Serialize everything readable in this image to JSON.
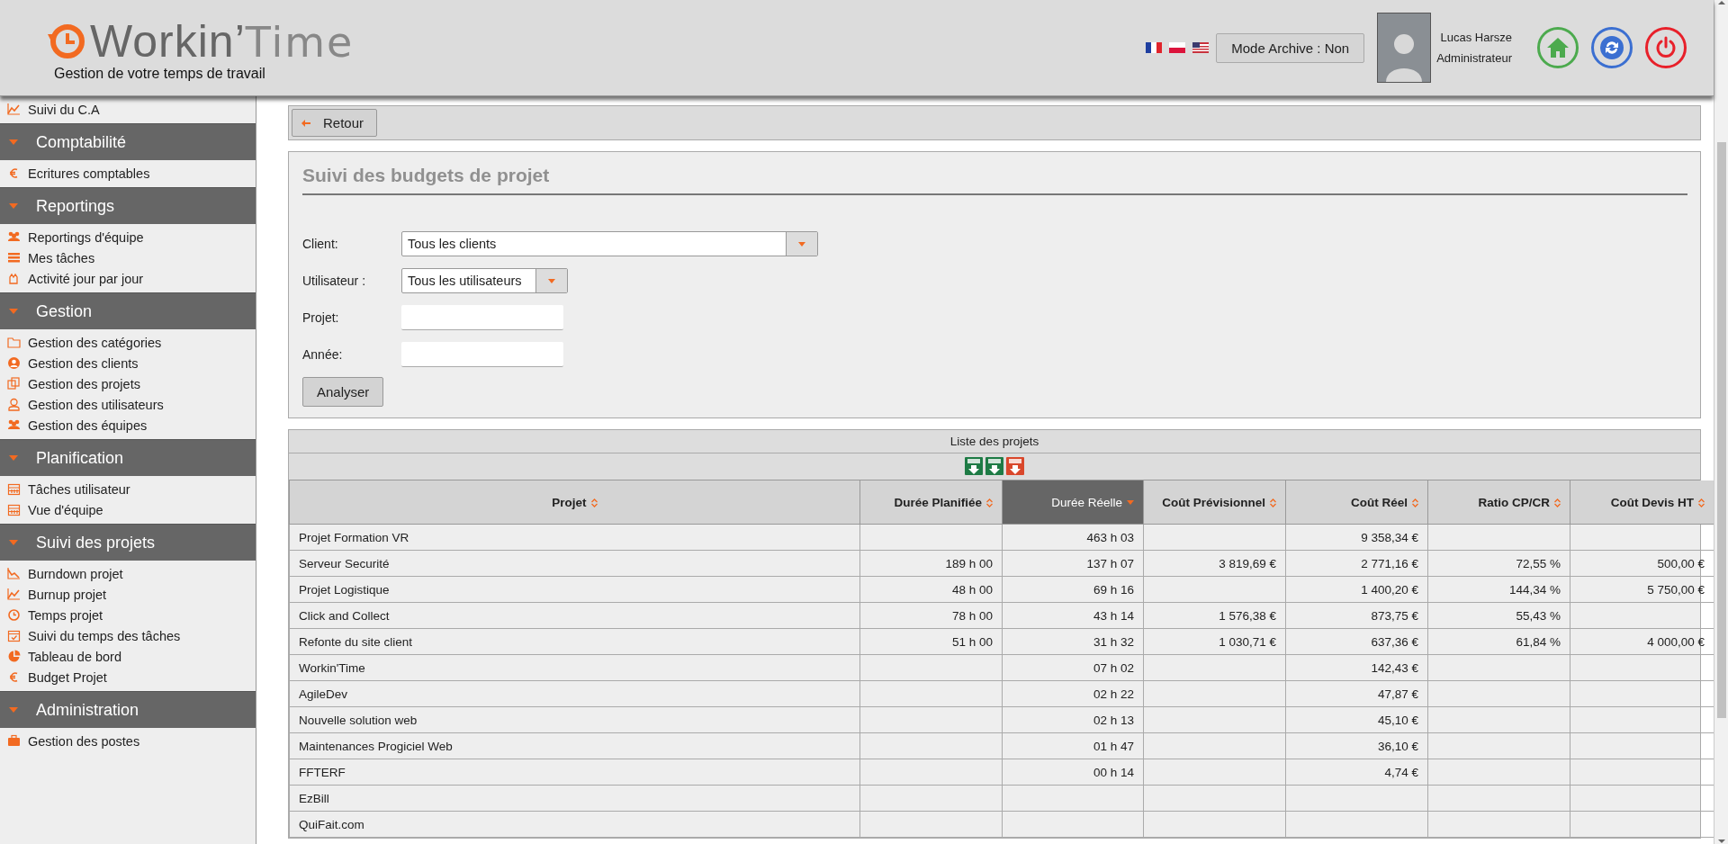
{
  "header": {
    "logo": {
      "bold": "Workin’",
      "light": "Time"
    },
    "tagline": "Gestion de votre temps de travail",
    "archive_button": "Mode Archive : Non",
    "user": {
      "name": "Lucas Harsze",
      "role": "Administrateur"
    }
  },
  "sidebar": {
    "top_items": [
      {
        "label": "Suivi du C.A"
      }
    ],
    "sections": [
      {
        "title": "Comptabilité",
        "items": [
          {
            "label": "Ecritures comptables"
          }
        ]
      },
      {
        "title": "Reportings",
        "items": [
          {
            "label": "Reportings d'équipe"
          },
          {
            "label": "Mes tâches"
          },
          {
            "label": "Activité jour par jour"
          }
        ]
      },
      {
        "title": "Gestion",
        "items": [
          {
            "label": "Gestion des catégories"
          },
          {
            "label": "Gestion des clients"
          },
          {
            "label": "Gestion des projets"
          },
          {
            "label": "Gestion des utilisateurs"
          },
          {
            "label": "Gestion des équipes"
          }
        ]
      },
      {
        "title": "Planification",
        "items": [
          {
            "label": "Tâches utilisateur"
          },
          {
            "label": "Vue d'équipe"
          }
        ]
      },
      {
        "title": "Suivi des projets",
        "items": [
          {
            "label": "Burndown projet"
          },
          {
            "label": "Burnup projet"
          },
          {
            "label": "Temps projet"
          },
          {
            "label": "Suivi du temps des tâches"
          },
          {
            "label": "Tableau de bord"
          },
          {
            "label": "Budget Projet"
          }
        ]
      },
      {
        "title": "Administration",
        "items": [
          {
            "label": "Gestion des postes"
          }
        ]
      }
    ]
  },
  "back_button": "Retour",
  "form": {
    "title": "Suivi des budgets de projet",
    "fields": [
      {
        "kind": "select",
        "label": "Client:",
        "value": "Tous les clients"
      },
      {
        "kind": "select",
        "label": "Utilisateur :",
        "value": "Tous les utilisateurs"
      },
      {
        "kind": "text",
        "label": "Projet:"
      },
      {
        "kind": "text",
        "label": "Année:"
      }
    ],
    "submit": "Analyser"
  },
  "table": {
    "title": "Liste des projets",
    "exports": [
      {
        "color": "#1e7b45"
      },
      {
        "color": "#1e7b45"
      },
      {
        "color": "#d9472b"
      }
    ],
    "columns": [
      {
        "label": "Projet",
        "sorted": false
      },
      {
        "label": "Durée Planifiée",
        "sorted": false
      },
      {
        "label": "Durée Réelle",
        "sorted": true
      },
      {
        "label": "Coût Prévisionnel",
        "sorted": false
      },
      {
        "label": "Coût Réel",
        "sorted": false
      },
      {
        "label": "Ratio CP/CR",
        "sorted": false
      },
      {
        "label": "Coût Devis HT",
        "sorted": false
      }
    ],
    "rows": [
      [
        "Projet Formation VR",
        "",
        "463 h 03",
        "",
        "9 358,34 €",
        "",
        ""
      ],
      [
        "Serveur Securité",
        "189 h 00",
        "137 h 07",
        "3 819,69 €",
        "2 771,16 €",
        "72,55 %",
        "500,00 €"
      ],
      [
        "Projet Logistique",
        "48 h 00",
        "69 h 16",
        "",
        "1 400,20 €",
        "144,34 %",
        "5 750,00 €"
      ],
      [
        "Click and Collect",
        "78 h 00",
        "43 h 14",
        "1 576,38 €",
        "873,75 €",
        "55,43 %",
        ""
      ],
      [
        "Refonte du site client",
        "51 h 00",
        "31 h 32",
        "1 030,71 €",
        "637,36 €",
        "61,84 %",
        "4 000,00 €"
      ],
      [
        "Workin'Time",
        "",
        "07 h 02",
        "",
        "142,43 €",
        "",
        ""
      ],
      [
        "AgileDev",
        "",
        "02 h 22",
        "",
        "47,87 €",
        "",
        ""
      ],
      [
        "Nouvelle solution web",
        "",
        "02 h 13",
        "",
        "45,10 €",
        "",
        ""
      ],
      [
        "Maintenances Progiciel Web",
        "",
        "01 h 47",
        "",
        "36,10 €",
        "",
        ""
      ],
      [
        "FFTERF",
        "",
        "00 h 14",
        "",
        "4,74 €",
        "",
        ""
      ],
      [
        "EzBill",
        "",
        "",
        "",
        "",
        "",
        ""
      ],
      [
        "QuiFait.com",
        "",
        "",
        "",
        "",
        "",
        ""
      ]
    ]
  }
}
